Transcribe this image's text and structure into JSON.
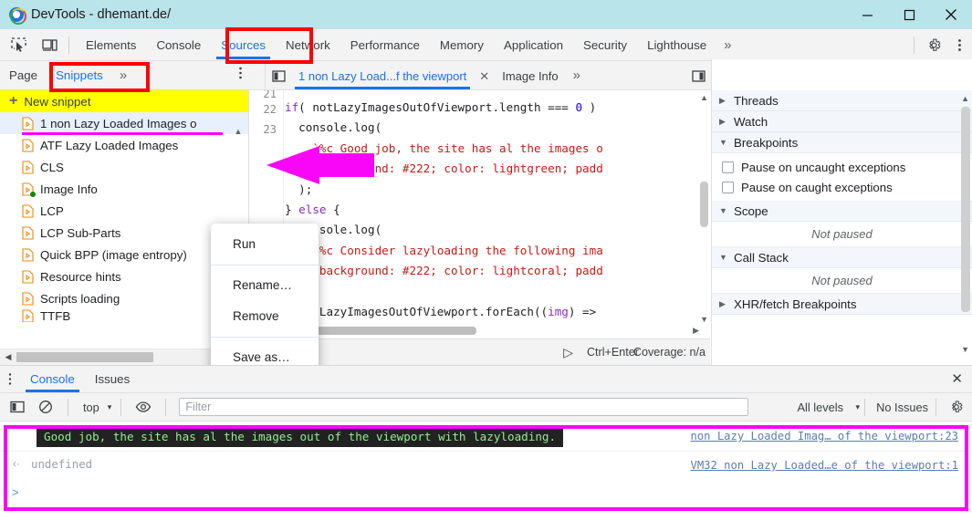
{
  "window": {
    "title": "DevTools - dhemant.de/",
    "app_icon": "chrome-devtools-icon",
    "minimize": "—",
    "maximize": "□",
    "close": "✕"
  },
  "devtools_tabs": {
    "inspect_icon": "inspect-element-icon",
    "device_icon": "device-toolbar-icon",
    "items": [
      {
        "label": "Elements",
        "active": false
      },
      {
        "label": "Console",
        "active": false
      },
      {
        "label": "Sources",
        "active": true
      },
      {
        "label": "Network",
        "active": false
      },
      {
        "label": "Performance",
        "active": false
      },
      {
        "label": "Memory",
        "active": false
      },
      {
        "label": "Application",
        "active": false
      },
      {
        "label": "Security",
        "active": false
      },
      {
        "label": "Lighthouse",
        "active": false
      }
    ],
    "more_tabs": "»",
    "settings_icon": "gear-icon",
    "more_options_icon": "kebab-menu-icon"
  },
  "navigator_bar": {
    "tabs": [
      {
        "label": "Page",
        "active": false
      },
      {
        "label": "Snippets",
        "active": true
      }
    ],
    "more": "»",
    "more_options_icon": "kebab-menu-icon"
  },
  "navigator": {
    "new_snippet_label": "New snippet",
    "new_snippet_icon": "plus-icon",
    "snippets": [
      {
        "label": "1 non Lazy Loaded Images o",
        "selected": true,
        "running": false
      },
      {
        "label": "ATF Lazy Loaded Images",
        "selected": false,
        "running": false
      },
      {
        "label": "CLS",
        "selected": false,
        "running": false
      },
      {
        "label": "Image Info",
        "selected": false,
        "running": true
      },
      {
        "label": "LCP",
        "selected": false,
        "running": false
      },
      {
        "label": "LCP Sub-Parts",
        "selected": false,
        "running": false
      },
      {
        "label": "Quick BPP (image entropy)",
        "selected": false,
        "running": false
      },
      {
        "label": "Resource hints",
        "selected": false,
        "running": false
      },
      {
        "label": "Scripts loading",
        "selected": false,
        "running": false
      },
      {
        "label": "TTFB",
        "selected": false,
        "running": false
      }
    ]
  },
  "context_menu": {
    "items": [
      {
        "label": "Run"
      },
      {
        "label": "Rename…"
      },
      {
        "label": "Remove"
      },
      {
        "label": "Save as…"
      }
    ]
  },
  "editor": {
    "panel_toggle_icon": "show-navigator-icon",
    "tabs": [
      {
        "label": "1 non Lazy Load...f the viewport",
        "active": true,
        "close": "✕"
      },
      {
        "label": "Image Info",
        "active": false
      }
    ],
    "more_tabs": "»",
    "show_debugger_icon": "show-debugger-icon",
    "line_numbers": [
      "21",
      "22",
      "23"
    ],
    "code": [
      "if( notLazyImagesOutOfViewport.length === 0 )",
      "  console.log(",
      "    `%c Good job, the site has al the images o",
      "    \"background: #222; color: lightgreen; padd",
      "  );",
      "} else {",
      "  console.log(",
      "    `%c Consider lazyloading the following ima",
      "    \"background: #222; color: lightcoral; padd",
      "  );",
      "  notLazyImagesOutOfViewport.forEach((img) =>",
      "}"
    ],
    "status": {
      "format_icon": "{}",
      "run_icon": "▷",
      "shortcut": "Ctrl+Enter",
      "coverage": "Coverage: n/a"
    }
  },
  "debugger": {
    "toolbar_icons": [
      "pause-script-icon",
      "step-over-icon",
      "step-into-icon",
      "step-out-icon",
      "step-icon",
      "deactivate-breakpoints-icon"
    ],
    "sections": [
      {
        "label": "Threads",
        "expanded": false
      },
      {
        "label": "Watch",
        "expanded": false
      },
      {
        "label": "Breakpoints",
        "expanded": true
      },
      {
        "label": "Scope",
        "expanded": true
      },
      {
        "label": "Call Stack",
        "expanded": true
      },
      {
        "label": "XHR/fetch Breakpoints",
        "expanded": false
      }
    ],
    "breakpoint_options": [
      {
        "label": "Pause on uncaught exceptions",
        "checked": false
      },
      {
        "label": "Pause on caught exceptions",
        "checked": false
      }
    ],
    "scope_state": "Not paused",
    "callstack_state": "Not paused"
  },
  "drawer": {
    "more_options_icon": "kebab-menu-icon",
    "tabs": [
      {
        "label": "Console",
        "active": true
      },
      {
        "label": "Issues",
        "active": false
      }
    ],
    "close_icon": "✕",
    "toolbar": {
      "sidebar_icon": "console-sidebar-icon",
      "clear_icon": "clear-console-icon",
      "context": "top",
      "context_caret": "▾",
      "eye_icon": "live-expression-icon",
      "filter_placeholder": "Filter",
      "levels": "All levels",
      "levels_caret": "▾",
      "issues": "No Issues",
      "settings_icon": "gear-icon"
    },
    "messages": [
      {
        "text": "Good job, the site has al the images out of the viewport with lazyloading.",
        "style": "styled-log",
        "source": "non Lazy Loaded Imag… of the viewport:23"
      },
      {
        "text": "undefined",
        "style": "result",
        "arrow": "‹·",
        "source": "VM32 non Lazy Loaded…e of the viewport:1"
      }
    ],
    "prompt": ">"
  },
  "annotations": {
    "red_color": "#ff0000",
    "magenta_color": "#f906f9",
    "yellow_color": "#ffff00",
    "boxes": [
      "sources-tab",
      "snippets-tab",
      "console-output"
    ],
    "arrow_target": "Run"
  }
}
